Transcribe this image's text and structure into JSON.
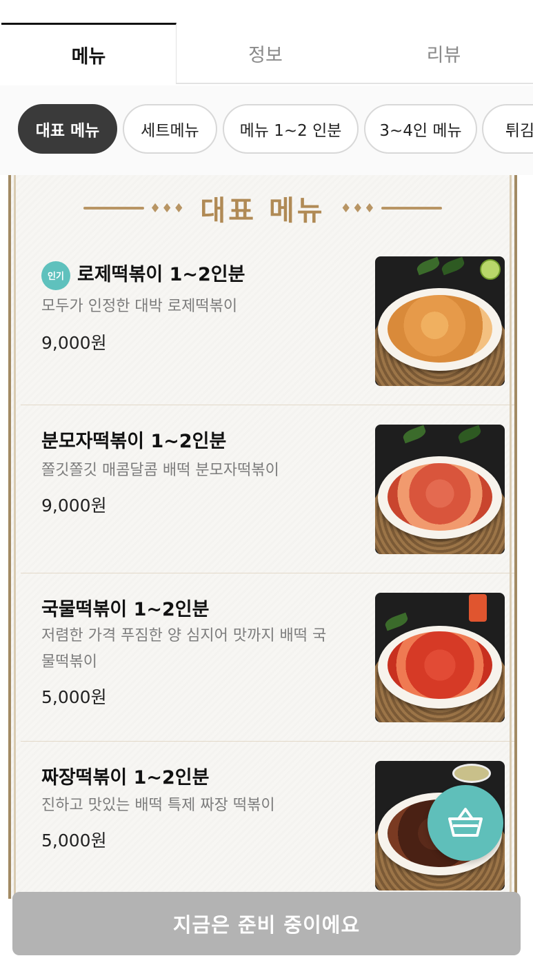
{
  "tabs": [
    {
      "label": "메뉴",
      "active": true
    },
    {
      "label": "정보",
      "active": false
    },
    {
      "label": "리뷰",
      "active": false
    }
  ],
  "categories": [
    {
      "label": "대표 메뉴",
      "active": true
    },
    {
      "label": "세트메뉴",
      "active": false
    },
    {
      "label": "메뉴  1~2 인분",
      "active": false
    },
    {
      "label": "3~4인 메뉴",
      "active": false
    },
    {
      "label": "튀김",
      "active": false
    }
  ],
  "section": {
    "title": "대표 메뉴",
    "deco_left": "♦♦♦",
    "deco_right": "♦♦♦"
  },
  "menu_items": [
    {
      "badge": "인기",
      "name": "로제떡볶이 1~2인분",
      "description": "모두가 인정한 대박 로제떡볶이",
      "price": "9,000원"
    },
    {
      "badge": "",
      "name": "분모자떡볶이 1~2인분",
      "description": "쫄깃쫄깃 매콤달콤 배떡 분모자떡볶이",
      "price": "9,000원"
    },
    {
      "badge": "",
      "name": "국물떡볶이 1~2인분",
      "description": "저렴한 가격 푸짐한 양 심지어 맛까지  배떡 국물떡볶이",
      "price": "5,000원"
    },
    {
      "badge": "",
      "name": "짜장떡볶이 1~2인분",
      "description": "진하고 맛있는 배떡 특제 짜장 떡볶이",
      "price": "5,000원"
    }
  ],
  "cart": {
    "icon": "basket-icon"
  },
  "bottom_button": {
    "label": "지금은 준비 중이에요"
  },
  "colors": {
    "accent": "#5fc1bd",
    "gold": "#b08a55",
    "chip_active": "#3a3a3a",
    "disabled_button": "#b3b3b3"
  }
}
